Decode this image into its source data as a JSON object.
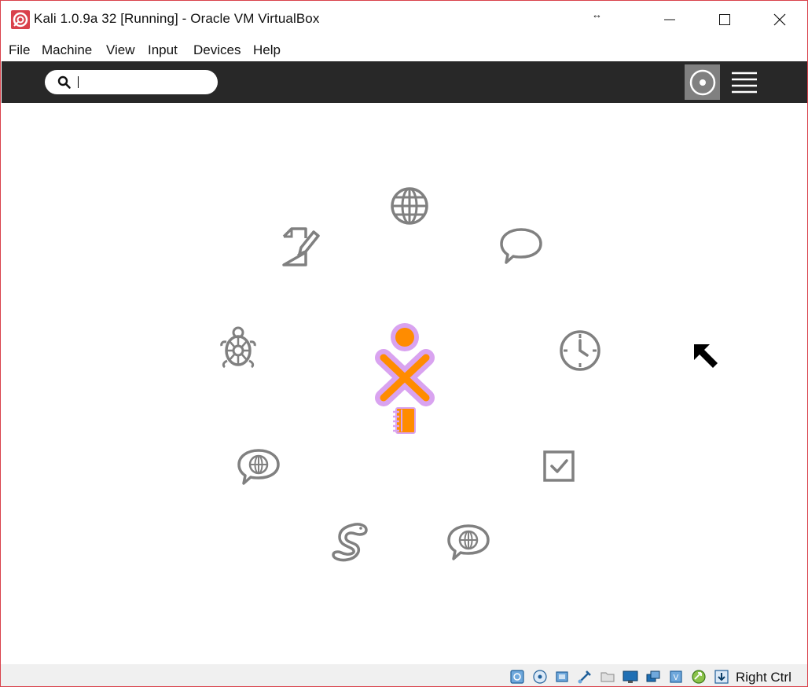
{
  "window": {
    "title": "Kali 1.0.9a 32 [Running] - Oracle VM VirtualBox",
    "resize_glyph": "↔"
  },
  "menubar": {
    "items": [
      {
        "label": "File"
      },
      {
        "label": "Machine"
      },
      {
        "label": "View"
      },
      {
        "label": "Input"
      },
      {
        "label": "Devices"
      },
      {
        "label": "Help"
      }
    ]
  },
  "sugar_toolbar": {
    "search": {
      "value": "",
      "placeholder": ""
    }
  },
  "home": {
    "buddy_colors": {
      "stroke": "#d9a3f0",
      "fill": "#ff8c00"
    },
    "activities": [
      {
        "icon": "globe-icon"
      },
      {
        "icon": "write-icon"
      },
      {
        "icon": "chat-icon"
      },
      {
        "icon": "turtle-icon"
      },
      {
        "icon": "clock-icon"
      },
      {
        "icon": "speech-globe-icon"
      },
      {
        "icon": "checkbox-icon"
      },
      {
        "icon": "snake-icon"
      },
      {
        "icon": "speech-globe-icon"
      },
      {
        "icon": "journal-icon"
      }
    ]
  },
  "statusbar": {
    "host_key": "Right Ctrl"
  },
  "colors": {
    "window_border": "#d9414b",
    "toolbar_bg": "#282828",
    "icon_gray": "#808080",
    "statusbar_bg": "#f0f0f0"
  }
}
